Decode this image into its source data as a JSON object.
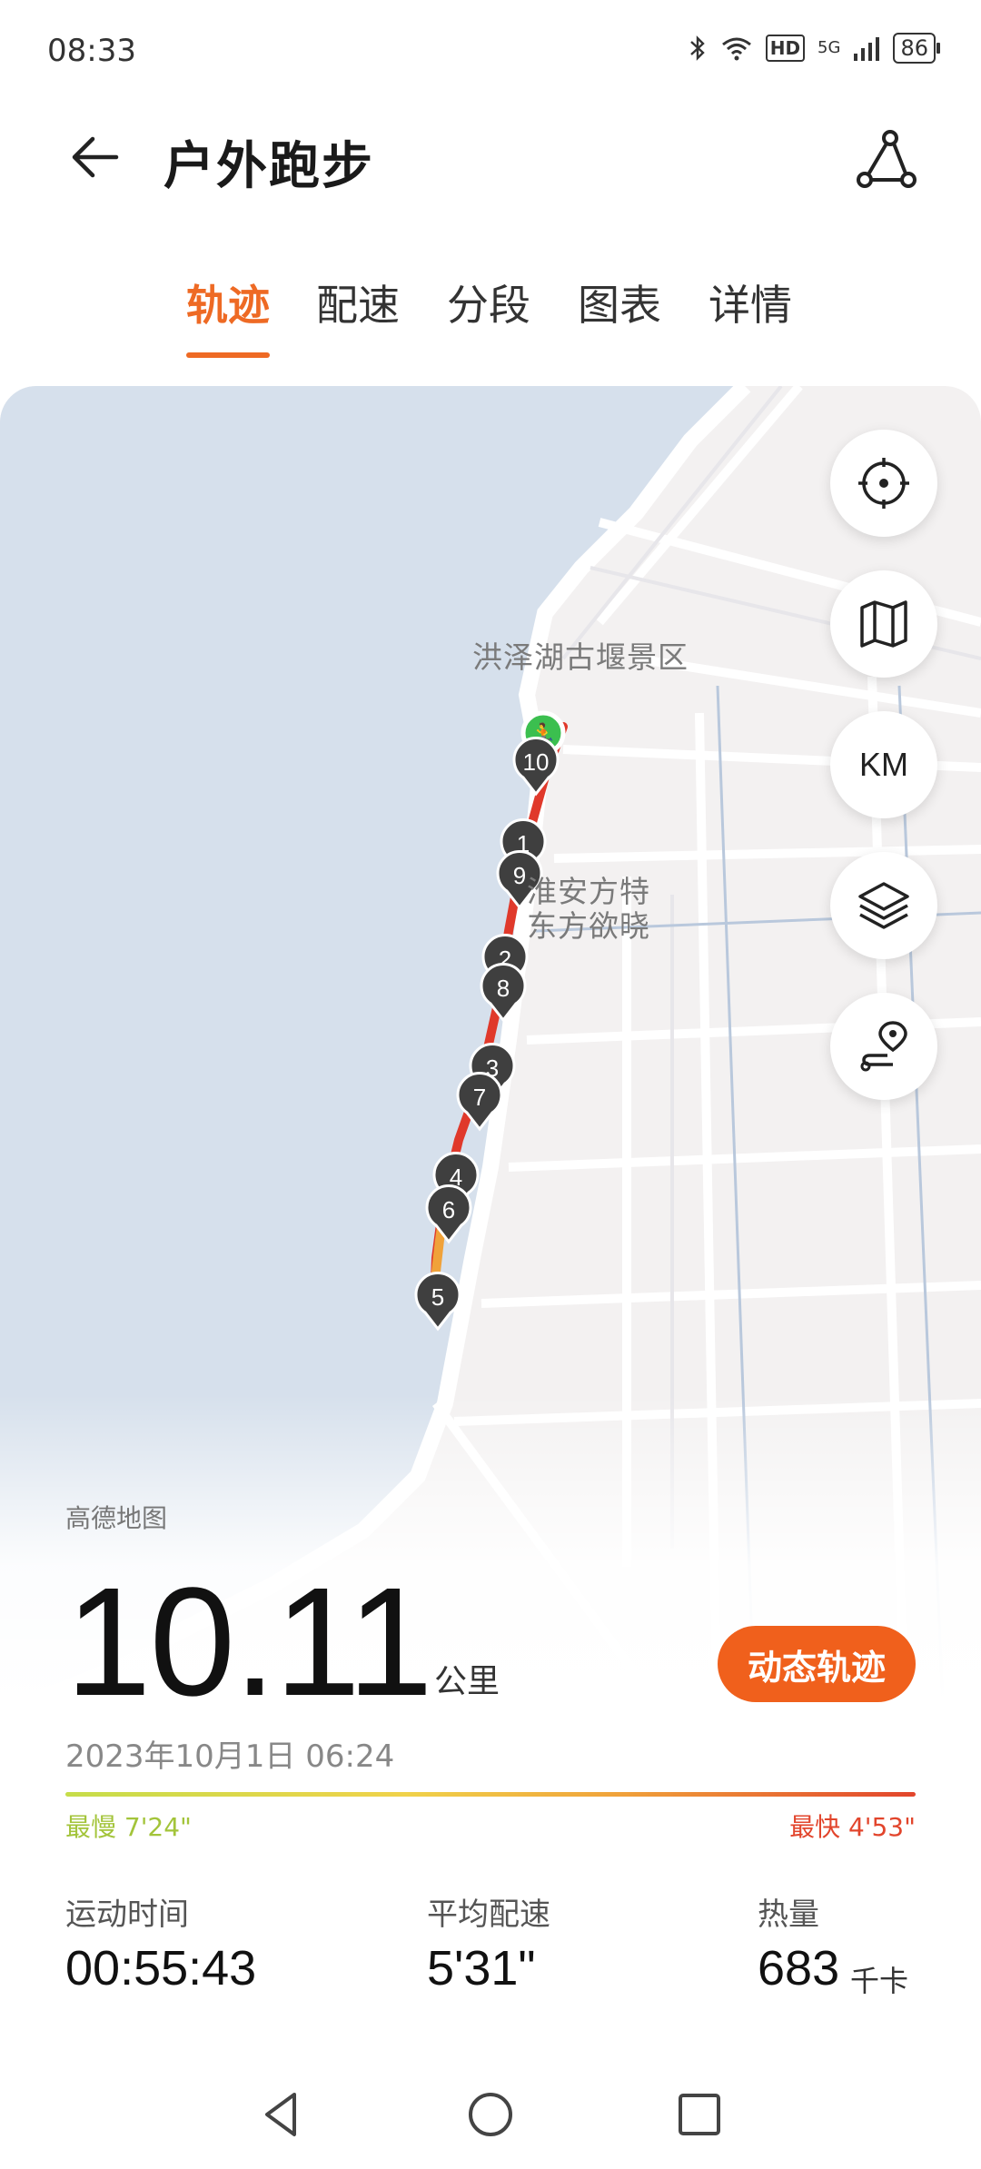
{
  "status_bar": {
    "time": "08:33",
    "hd_label": "HD",
    "signal_label": "5G",
    "battery": "86",
    "icons": [
      "bluetooth-icon",
      "wifi-icon",
      "signal-icon",
      "battery-icon"
    ]
  },
  "header": {
    "title": "户外跑步",
    "back_icon": "arrow-left-icon",
    "share_icon": "route-share-icon"
  },
  "tabs": [
    {
      "label": "轨迹",
      "active": true
    },
    {
      "label": "配速",
      "active": false
    },
    {
      "label": "分段",
      "active": false
    },
    {
      "label": "图表",
      "active": false
    },
    {
      "label": "详情",
      "active": false
    }
  ],
  "map": {
    "labels": {
      "scenic": "洪泽湖古堰景区",
      "poi_line1": "淮安方特",
      "poi_line2": "东方欲晓"
    },
    "markers": [
      "1",
      "2",
      "3",
      "4",
      "5",
      "6",
      "7",
      "8",
      "9",
      "10"
    ],
    "controls": [
      "locate-icon",
      "map-icon",
      "KM",
      "layers-icon",
      "route-icon"
    ],
    "km_label": "KM",
    "provider": "高德地图",
    "colors": {
      "water": "#d6e0ec",
      "land": "#f3f1f1",
      "route_fast": "#e0392b",
      "route_slow": "#f0a23a",
      "start": "#3bbf4f"
    }
  },
  "summary": {
    "distance": "10.11",
    "distance_unit": "公里",
    "dynamic_button": "动态轨迹",
    "datetime": "2023年10月1日 06:24",
    "slowest": "最慢 7'24\"",
    "fastest": "最快 4'53\"",
    "stats": [
      {
        "label": "运动时间",
        "value": "00:55:43",
        "unit": ""
      },
      {
        "label": "平均配速",
        "value": "5'31\"",
        "unit": ""
      },
      {
        "label": "热量",
        "value": "683",
        "unit": "千卡"
      }
    ]
  },
  "navbar": [
    "back-triangle-icon",
    "home-circle-icon",
    "recent-square-icon"
  ]
}
